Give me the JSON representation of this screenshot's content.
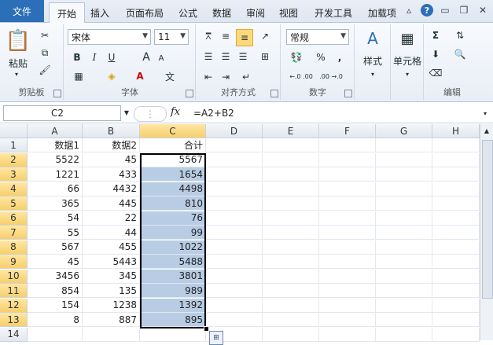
{
  "tabs": {
    "file": "文件",
    "items": [
      {
        "label": "开始",
        "active": true
      },
      {
        "label": "插入"
      },
      {
        "label": "页面布局"
      },
      {
        "label": "公式"
      },
      {
        "label": "数据"
      },
      {
        "label": "审阅"
      },
      {
        "label": "视图"
      },
      {
        "label": "开发工具"
      },
      {
        "label": "加载项"
      }
    ]
  },
  "ribbon": {
    "clipboard": {
      "label": "剪贴板",
      "paste": "粘贴"
    },
    "font": {
      "label": "字体",
      "name": "宋体",
      "size": "11",
      "bold": "B",
      "italic": "I",
      "underline": "U",
      "grow": "A",
      "shrink": "A",
      "phonetic": "文"
    },
    "alignment": {
      "label": "对齐方式"
    },
    "number": {
      "label": "数字",
      "format": "常规",
      "percent": "%",
      "comma": ",",
      "inc": "←.0 .00",
      "dec": ".00 →.0"
    },
    "styles": {
      "label": "样式"
    },
    "cells": {
      "label": "单元格"
    },
    "editing": {
      "label": "编辑",
      "sum": "Σ"
    }
  },
  "formula": {
    "name_box": "C2",
    "fx": "fx",
    "content": "=A2+B2"
  },
  "columns": [
    "A",
    "B",
    "C",
    "D",
    "E",
    "F",
    "G",
    "H"
  ],
  "rows": [
    {
      "n": "1",
      "a": "数据1",
      "b": "数据2",
      "c": "合计"
    },
    {
      "n": "2",
      "a": "5522",
      "b": "45",
      "c": "5567"
    },
    {
      "n": "3",
      "a": "1221",
      "b": "433",
      "c": "1654"
    },
    {
      "n": "4",
      "a": "66",
      "b": "4432",
      "c": "4498"
    },
    {
      "n": "5",
      "a": "365",
      "b": "445",
      "c": "810"
    },
    {
      "n": "6",
      "a": "54",
      "b": "22",
      "c": "76"
    },
    {
      "n": "7",
      "a": "55",
      "b": "44",
      "c": "99"
    },
    {
      "n": "8",
      "a": "567",
      "b": "455",
      "c": "1022"
    },
    {
      "n": "9",
      "a": "45",
      "b": "5443",
      "c": "5488"
    },
    {
      "n": "10",
      "a": "3456",
      "b": "345",
      "c": "3801"
    },
    {
      "n": "11",
      "a": "854",
      "b": "135",
      "c": "989"
    },
    {
      "n": "12",
      "a": "154",
      "b": "1238",
      "c": "1392"
    },
    {
      "n": "13",
      "a": "8",
      "b": "887",
      "c": "895"
    },
    {
      "n": "14",
      "a": "",
      "b": "",
      "c": ""
    }
  ],
  "colors": {
    "selection": "#b8cce4",
    "header_selected": "#f7cf6c",
    "file_tab": "#2a6fb8"
  }
}
